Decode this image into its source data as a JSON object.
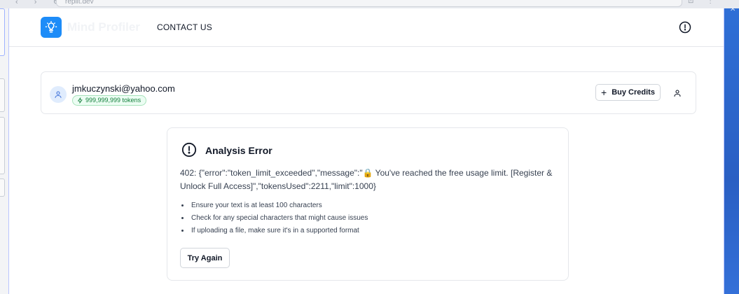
{
  "browser": {
    "url": "replit.dev"
  },
  "header": {
    "brand": "Mind Profiler",
    "nav_contact": "CONTACT US",
    "logo_icon": "lightbulb-icon",
    "alert_icon": "alert-circle-icon"
  },
  "user": {
    "email": "jmkuczynski@yahoo.com",
    "tokens": "999,999,999 tokens",
    "token_icon": "lightning-icon",
    "buy_credits": "Buy Credits",
    "profile_icon": "user-icon"
  },
  "error": {
    "title": "Analysis Error",
    "message": "402: {\"error\":\"token_limit_exceeded\",\"message\":\"🔒 You've reached the free usage limit. [Register & Unlock Full Access]\",\"tokensUsed\":2211,\"limit\":1000}",
    "tips": [
      "Ensure your text is at least 100 characters",
      "Check for any special characters that might cause issues",
      "If uploading a file, make sure it's in a supported format"
    ],
    "try_again": "Try Again"
  },
  "colors": {
    "accent": "#1d8cf8",
    "token_badge_bg": "#ecfdf3",
    "token_badge_text": "#15803d"
  }
}
